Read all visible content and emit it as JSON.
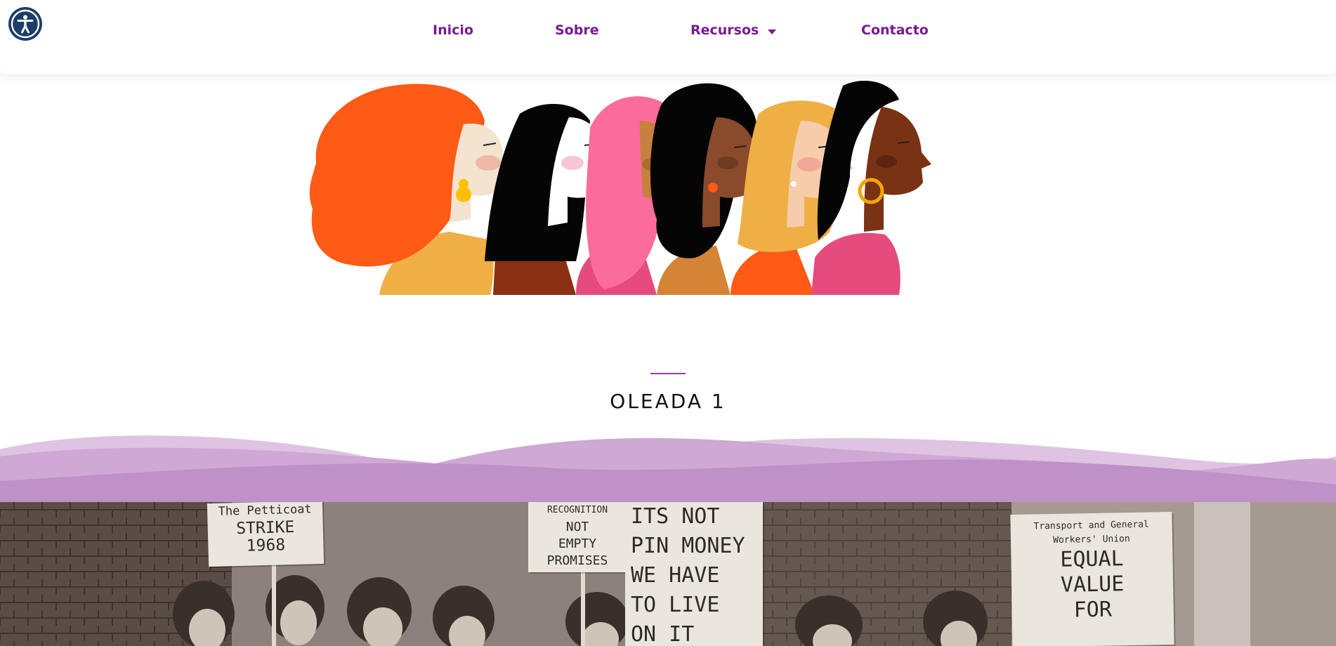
{
  "accessibility": {
    "icon": "accessibility-icon"
  },
  "nav": {
    "items": [
      {
        "label": "Inicio"
      },
      {
        "label": "Sobre"
      },
      {
        "label": "Recursos",
        "icon": "caret-down-icon"
      },
      {
        "label": "Contacto"
      }
    ]
  },
  "section": {
    "title": "OLEADA 1"
  },
  "photo": {
    "signs": [
      {
        "lines": [
          "The Petticoat",
          "STRIKE",
          "1968"
        ]
      },
      {
        "lines": [
          "RECOGNITION",
          "NOT",
          "EMPTY",
          "PROMISES"
        ]
      },
      {
        "lines": [
          "ITS NOT",
          "PIN MONEY",
          "WE HAVE",
          "TO LIVE",
          "ON IT"
        ]
      },
      {
        "lines": [
          "Transport and General",
          "Workers' Union",
          "EQUAL",
          "VALUE",
          "FOR"
        ]
      }
    ]
  },
  "colors": {
    "nav_text": "#7a1a8f",
    "accent": "#8e3fa3",
    "wave_light": "#dfc3e2",
    "wave_mid": "#cfa8d5",
    "wave_dark": "#c090c8",
    "a11y_bg": "#1d3d69"
  }
}
